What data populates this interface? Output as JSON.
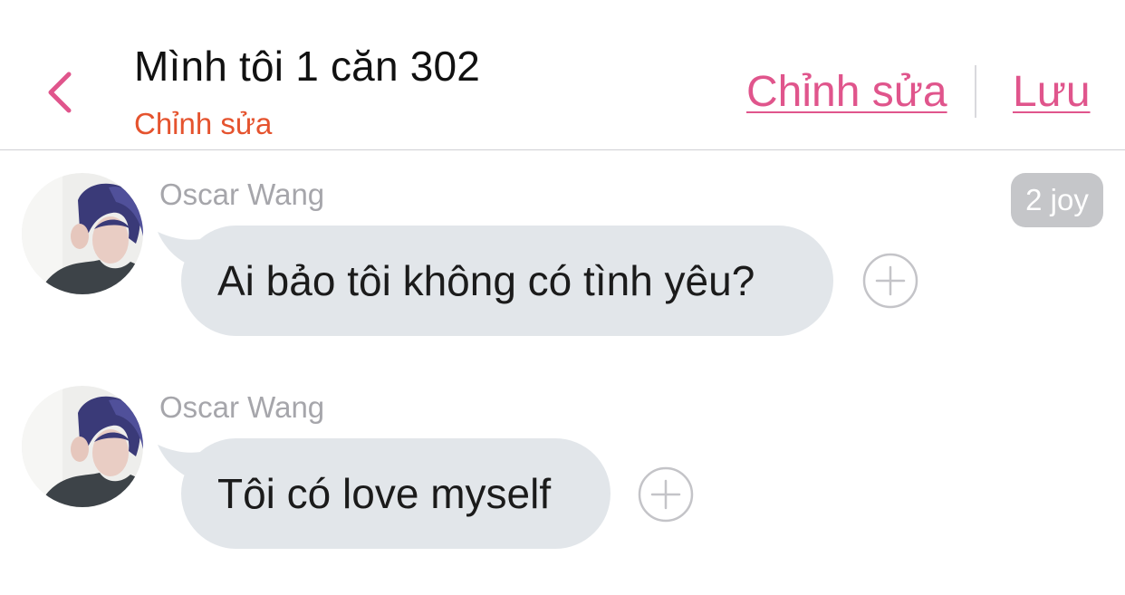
{
  "header": {
    "title": "Mình tôi 1 căn 302",
    "subtitle": "Chỉnh sửa",
    "edit_label": "Chỉnh sửa",
    "save_label": "Lưu",
    "back_icon": "chevron-left-icon"
  },
  "messages": [
    {
      "sender": "Oscar Wang",
      "text": "Ai bảo tôi không có tình yêu?",
      "badge": "2 joy"
    },
    {
      "sender": "Oscar Wang",
      "text": "Tôi có love myself"
    }
  ],
  "colors": {
    "accent": "#e0558c",
    "subtitle": "#e5532e",
    "bubble": "#e2e6ea",
    "badge": "#c5c6c9"
  }
}
